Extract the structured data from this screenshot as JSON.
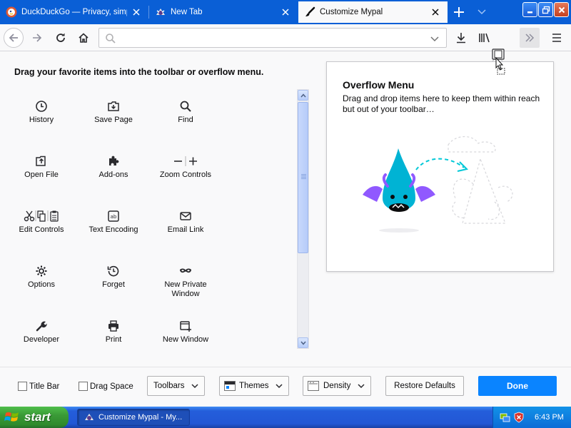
{
  "tabs": [
    {
      "title": "DuckDuckGo — Privacy, simplified.",
      "icon": "duckduckgo-icon",
      "active": false
    },
    {
      "title": "New Tab",
      "icon": "mypal-icon",
      "active": false
    },
    {
      "title": "Customize Mypal",
      "icon": "paintbrush-icon",
      "active": true
    }
  ],
  "urlbar": {
    "value": "",
    "placeholder": ""
  },
  "palette": {
    "heading": "Drag your favorite items into the toolbar or overflow menu.",
    "items": [
      {
        "label": "History",
        "icon": "clock-icon"
      },
      {
        "label": "Save Page",
        "icon": "save-page-icon"
      },
      {
        "label": "Find",
        "icon": "magnifier-icon"
      },
      {
        "label": "Open File",
        "icon": "open-file-icon"
      },
      {
        "label": "Add-ons",
        "icon": "puzzle-icon"
      },
      {
        "label": "Zoom Controls",
        "icon": "zoom-controls-icon"
      },
      {
        "label": "Edit Controls",
        "icon": "edit-controls-icon"
      },
      {
        "label": "Text Encoding",
        "icon": "text-encoding-icon"
      },
      {
        "label": "Email Link",
        "icon": "envelope-icon"
      },
      {
        "label": "Options",
        "icon": "gear-icon"
      },
      {
        "label": "Forget",
        "icon": "forget-icon"
      },
      {
        "label": "New Private Window",
        "icon": "mask-icon"
      },
      {
        "label": "Developer",
        "icon": "wrench-icon"
      },
      {
        "label": "Print",
        "icon": "printer-icon"
      },
      {
        "label": "New Window",
        "icon": "new-window-icon"
      }
    ]
  },
  "overflow": {
    "title": "Overflow Menu",
    "description": "Drag and drop items here to keep them within reach but out of your toolbar…"
  },
  "bottom": {
    "title_bar": "Title Bar",
    "drag_space": "Drag Space",
    "toolbars": "Toolbars",
    "themes": "Themes",
    "density": "Density",
    "restore_defaults": "Restore Defaults",
    "done": "Done"
  },
  "taskbar": {
    "start": "start",
    "task_item": "Customize Mypal - My...",
    "clock": "6:43 PM"
  },
  "colors": {
    "tabstrip": "#0a5fd6",
    "accent_button": "#0a84ff",
    "taskbar": "#245edb",
    "start_button": "#3a9a37"
  }
}
